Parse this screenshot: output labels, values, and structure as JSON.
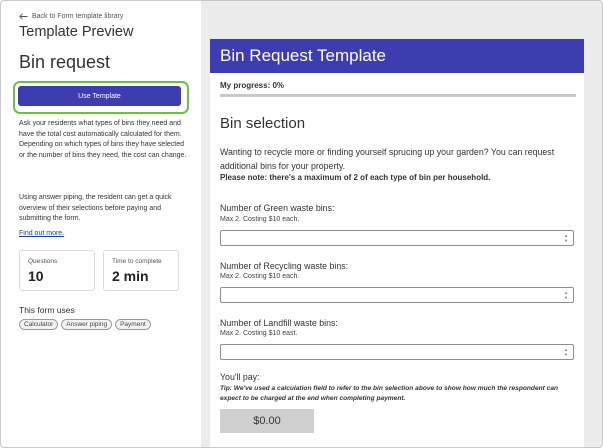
{
  "left": {
    "back_label": "Back to Form template library",
    "preview_title": "Template Preview",
    "form_title": "Bin request",
    "use_button": "Use Template",
    "description": "Ask your residents what types of  bins they need and have the total cost automatically calculated for  them. Depending on which types of bins they have selected or the number  of bins they need, the cost can change.",
    "description2": "Using answer piping, the resident can get a quick overview of their selections before paying and submitting the form.",
    "find_out": "Find out more.",
    "stats": [
      {
        "label": "Questions",
        "value": "10"
      },
      {
        "label": "Time to complete",
        "value": "2 min"
      }
    ],
    "uses_title": "This form uses",
    "tags": [
      "Calculator",
      "Answer piping",
      "Payment"
    ]
  },
  "form": {
    "header": "Bin Request Template",
    "progress_label": "My progress: 0%",
    "progress": 0,
    "section_title": "Bin selection",
    "intro": "Wanting to recycle more or finding yourself sprucing up your garden? You can request additional bins for your property.",
    "note": "Please note: there's a maximum of 2 of each type of bin per household.",
    "questions": [
      {
        "label": "Number of Green waste bins:",
        "sub": "Max 2. Costing $10 each.",
        "value": ""
      },
      {
        "label": "Number of Recycling waste bins:",
        "sub": "Max 2. Costing $10 each.",
        "value": ""
      },
      {
        "label": "Number of Landfill waste bins:",
        "sub": "Max 2. Costing $10 east.",
        "value": ""
      }
    ],
    "pay_label": "You'll pay:",
    "tip": "Tip: We've used a calculation field to refer to the bin selection above to show how much the respondent can expect to be charged at the end when completing payment.",
    "total": "$0.00"
  },
  "colors": {
    "accent": "#3d3db0",
    "highlight": "#6cc04a",
    "panel_bg": "#ececec"
  }
}
